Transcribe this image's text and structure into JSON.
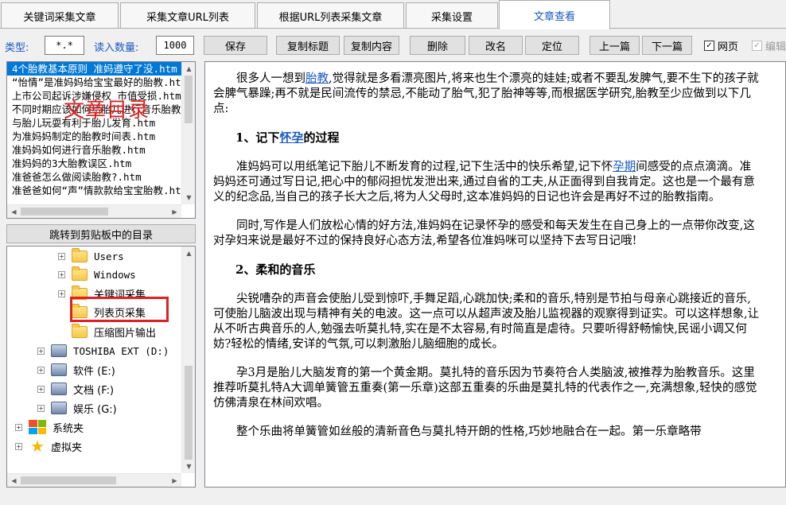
{
  "tabs": [
    {
      "label": "关键词采集文章"
    },
    {
      "label": "采集文章URL列表"
    },
    {
      "label": "根据URL列表采集文章"
    },
    {
      "label": "采集设置"
    },
    {
      "label": "文章查看",
      "active": true
    }
  ],
  "toolbar": {
    "type_label": "类型:",
    "type_value": "*.*",
    "count_label": "读入数量:",
    "count_value": "1000",
    "save_label": "保存",
    "copy_title_label": "复制标题",
    "copy_content_label": "复制内容",
    "delete_label": "删除",
    "rename_label": "改名",
    "locate_label": "定位",
    "prev_label": "上一篇",
    "next_label": "下一篇",
    "webpage_label": "网页",
    "webpage_checked": true,
    "edit_label": "编辑",
    "edit_checked": true
  },
  "file_list": [
    "4个胎教基本原则 准妈遵守了没.htm",
    "“怡情”是准妈妈给宝宝最好的胎教.htm",
    "上市公司起诉涉嫌侵权 市值受损.htm",
    "不同时期应该如何给胎儿进行音乐胎教.htm",
    "与胎儿玩耍有利于胎儿发育.htm",
    "为准妈妈制定的胎教时间表.htm",
    "准妈妈如何进行音乐胎教.htm",
    "准妈妈的3大胎教误区.htm",
    "准爸爸怎么做阅读胎教?.htm",
    "准爸爸如何“声”情款款给宝宝胎教.htm"
  ],
  "overlay_label": "文章目录",
  "jump_button_label": "跳转到剪贴板中的目录",
  "tree": {
    "folders": [
      "Users",
      "Windows",
      "关键词采集",
      "列表页采集",
      "压缩图片输出"
    ],
    "drives": [
      "TOSHIBA EXT (D:)",
      "软件 (E:)",
      "文档 (F:)",
      "娱乐 (G:)"
    ],
    "system": "系统夹",
    "virtual": "虚拟夹"
  },
  "article": {
    "p1_before": "很多人一想到",
    "p1_link": "胎教",
    "p1_after": ",觉得就是多看漂亮图片,将来也生个漂亮的娃娃;或者不要乱发脾气,要不生下的孩子就会脾气暴躁;再不就是民间流传的禁忌,不能动了胎气,犯了胎神等等,而根据医学研究,胎教至少应做到以下几点:",
    "h1_before": "1、记下",
    "h1_link": "怀孕",
    "h1_after": "的过程",
    "p2_before": "准妈妈可以用纸笔记下胎儿不断发育的过程,记下生活中的快乐希望,记下怀",
    "p2_link": "孕期",
    "p2_after": "间感受的点点滴滴。准妈妈还可通过写日记,把心中的郁闷担忧发泄出来,通过自省的工夫,从正面得到自我肯定。这也是一个最有意义的纪念品,当自己的孩子长大之后,将为人父母时,这本准妈妈的日记也许会是再好不过的胎教指南。",
    "p3": "同时,写作是人们放松心情的好方法,准妈妈在记录怀孕的感受和每天发生在自己身上的一点带你改变,这对孕妇来说是最好不过的保持良好心态方法,希望各位准妈咪可以坚持下去写日记哦!",
    "h2": "2、柔和的音乐",
    "p4": "尖锐嘈杂的声音会使胎儿受到惊吓,手舞足蹈,心跳加快;柔和的音乐,特别是节拍与母亲心跳接近的音乐,可使胎儿脑波出现与精神有关的电波。这一点可以从超声波及胎儿监视器的观察得到证实。可以这样想象,让从不听古典音乐的人,勉强去听莫扎特,实在是不太容易,有时简直是虐待。只要听得舒畅愉快,民谣小调又何妨?轻松的情绪,安详的气氛,可以刺激胎儿脑细胞的成长。",
    "p5": "孕3月是胎儿大脑发育的第一个黄金期。莫扎特的音乐因为节奏符合人类脑波,被推荐为胎教音乐。这里推荐听莫扎特A大调单簧管五重奏(第一乐章)这部五重奏的乐曲是莫扎特的代表作之一,充满想象,轻快的感觉仿佛清泉在林间欢唱。",
    "p6": "整个乐曲将单簧管如丝般的清新音色与莫扎特开朗的性格,巧妙地融合在一起。第一乐章略带"
  }
}
